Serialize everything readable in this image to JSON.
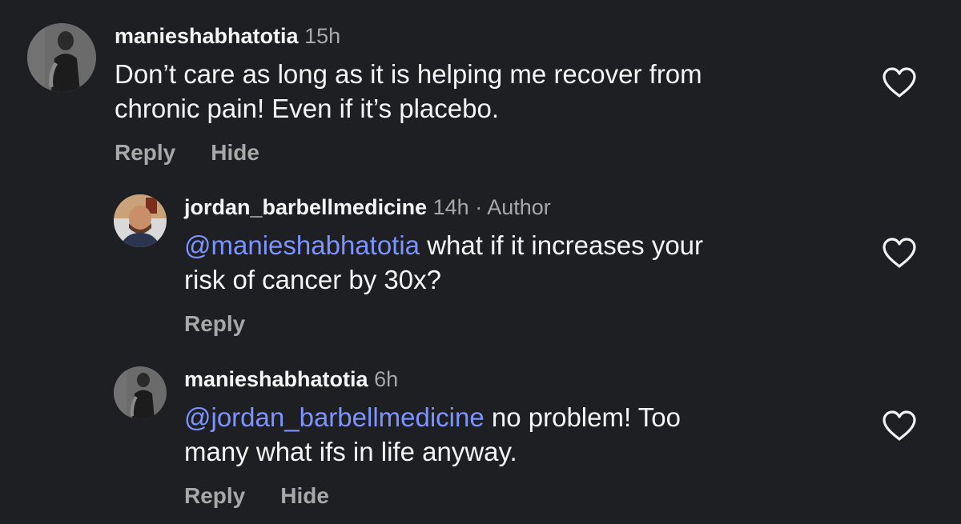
{
  "colors": {
    "background": "#1e1f22",
    "text": "#f5f5f5",
    "secondary_text": "#a8a8a8",
    "mention": "#7d93ff"
  },
  "comments": [
    {
      "username": "manieshabhatotia",
      "time": "15h",
      "author_tag": "",
      "mention": "",
      "text_line1": "Don’t care as long as it is helping me recover from",
      "text_line2": "chronic pain! Even if it’s placebo.",
      "reply_label": "Reply",
      "hide_label": "Hide",
      "like_icon": "heart-outline-icon"
    },
    {
      "username": "jordan_barbellmedicine",
      "time": "14h",
      "author_tag": "· Author",
      "mention": "@manieshabhatotia",
      "text_line1": " what if it increases your",
      "text_line2": "risk of cancer by 30x?",
      "reply_label": "Reply",
      "like_icon": "heart-outline-icon"
    },
    {
      "username": "manieshabhatotia",
      "time": "6h",
      "author_tag": "",
      "mention": "@jordan_barbellmedicine",
      "text_line1": " no problem! Too",
      "text_line2": "many what ifs in life anyway.",
      "reply_label": "Reply",
      "hide_label": "Hide",
      "like_icon": "heart-outline-icon"
    }
  ]
}
